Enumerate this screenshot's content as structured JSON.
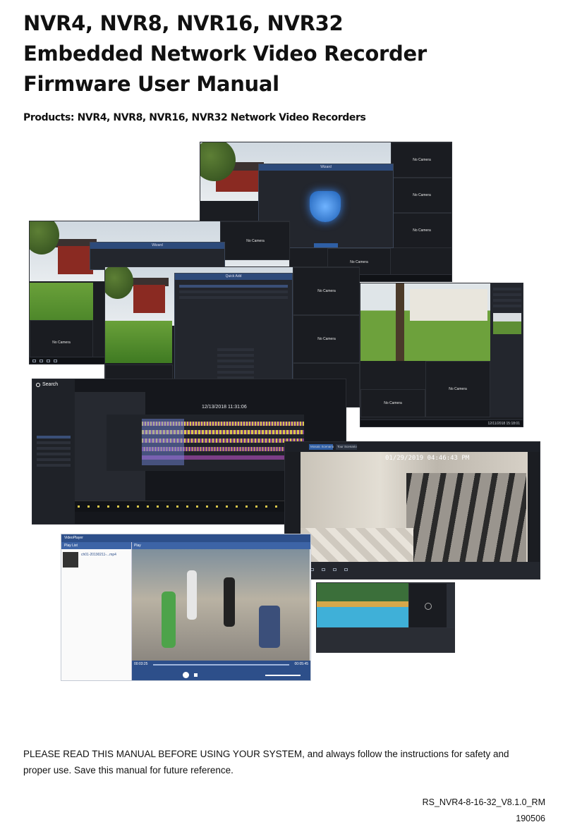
{
  "title_lines": [
    "NVR4, NVR8, NVR16, NVR32",
    "Embedded Network Video Recorder",
    "Firmware User Manual"
  ],
  "subtitle": "Products: NVR4, NVR8, NVR16, NVR32 Network Video Recorders",
  "screens": {
    "no_camera": "No Camera",
    "wizard": "Wizard",
    "quick_add": "Quick Add",
    "search": "Search",
    "timestamp_wizard": "12/13/2018 11:31:06",
    "timestamp_small": "12/11/2018 15:18:01",
    "escalator_timestamp": "01/29/2019 04:46:43 PM",
    "mosaic_tab_1": "Mosaic Scenario",
    "mosaic_tab_2": "Tour Scenario",
    "video_player_title": "VideoPlayer",
    "play_list": "Play List",
    "play_label": "Play",
    "file_name": "ch01-20190211-...mp4",
    "time_left": "00:03:25",
    "time_right": "00:05:45"
  },
  "footer_note": "PLEASE READ THIS MANUAL BEFORE USING YOUR SYSTEM, and always follow the instructions for safety and proper use. Save this manual for future reference.",
  "doc_id": "RS_NVR4-8-16-32_V8.1.0_RM",
  "doc_date": "190506",
  "colors": {
    "accent_blue": "#2f5fa5",
    "ui_dark": "#1b1d22",
    "timeline_yellow": "#d8c64a",
    "timeline_purple": "#7b3e86"
  }
}
